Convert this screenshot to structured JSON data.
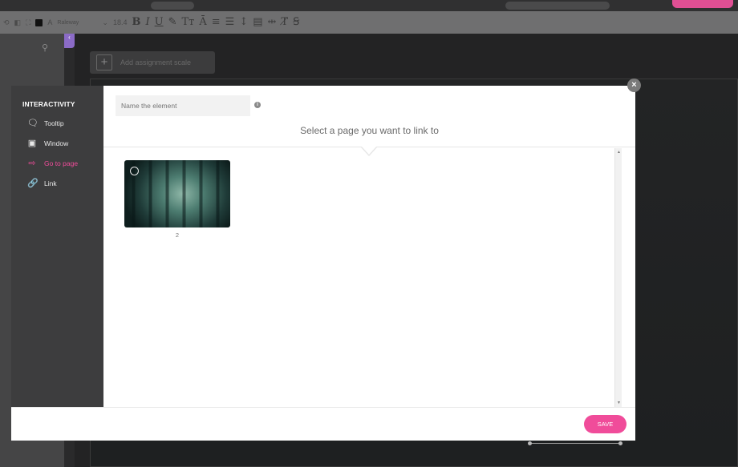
{
  "editor": {
    "font_name": "Raleway",
    "font_size": "18.4",
    "add_assignment_label": "Add assignment scale"
  },
  "modal": {
    "sidebar": {
      "title": "INTERACTIVITY",
      "items": [
        {
          "label": "Tooltip",
          "icon": "speech-bubble-icon",
          "active": false
        },
        {
          "label": "Window",
          "icon": "window-icon",
          "active": false
        },
        {
          "label": "Go to page",
          "icon": "go-to-page-arrow-icon",
          "active": true
        },
        {
          "label": "Link",
          "icon": "link-icon",
          "active": false
        }
      ]
    },
    "name_placeholder": "Name the element",
    "prompt": "Select a page you want to link to",
    "pages": [
      {
        "number": "2",
        "selected": false
      }
    ],
    "save_label": "SAVE"
  },
  "colors": {
    "accent": "#f04c9a",
    "sidebar_bg": "#3d3d3e",
    "toolbar_bg": "#6f6f70"
  }
}
